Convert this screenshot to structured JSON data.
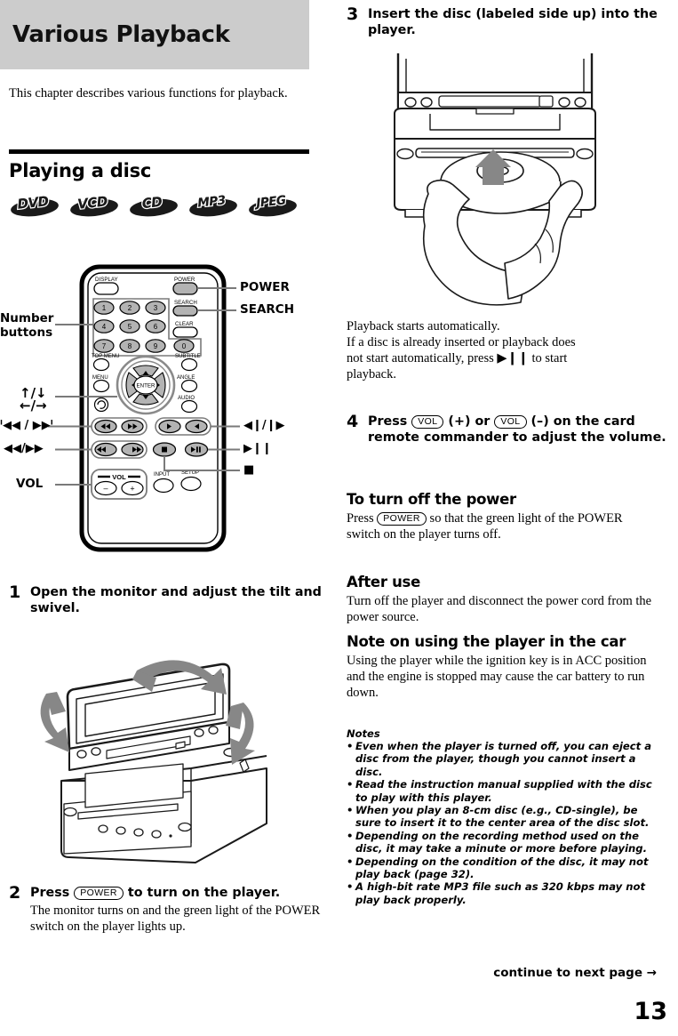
{
  "page": {
    "number": "13",
    "continue_label": "continue to next page",
    "continue_arrow": "→"
  },
  "chapter": {
    "title": "Various Playback",
    "intro": "This chapter describes various functions for playback.",
    "banner_color": "#cccccc"
  },
  "section": {
    "title": "Playing a disc",
    "media_badges": [
      "DVD",
      "VCD",
      "CD",
      "MP3",
      "JPEG"
    ]
  },
  "remote_figure": {
    "callouts_left": [
      {
        "label": "Number\nbuttons",
        "line1": "Number",
        "line2": "buttons"
      },
      {
        "label": "↑/↓",
        "line2": "←/→"
      },
      {
        "label": "ᑊ◀◀ / ▶▶ᑊ"
      },
      {
        "label": "◀◀/▶▶"
      },
      {
        "label": "VOL"
      }
    ],
    "callouts_right": [
      {
        "label": "POWER"
      },
      {
        "label": "SEARCH"
      },
      {
        "label": "◀❙/❙▶"
      },
      {
        "label": "▶❙❙"
      },
      {
        "label": "■"
      }
    ],
    "button_labels": {
      "display": "DISPLAY",
      "power": "POWER",
      "search": "SEARCH",
      "clear": "CLEAR",
      "top_menu": "TOP MENU",
      "subtitle": "SUBTITLE",
      "menu": "MENU",
      "angle": "ANGLE",
      "audio": "AUDIO",
      "enter": "ENTER",
      "input": "INPUT",
      "setup": "SETUP",
      "vol": "VOL",
      "vol_minus": "–",
      "vol_plus": "+"
    },
    "number_keys": [
      "1",
      "2",
      "3",
      "4",
      "5",
      "6",
      "7",
      "8",
      "9",
      "0"
    ]
  },
  "steps": [
    {
      "num": "1",
      "head": "Open the monitor and adjust the tilt and swivel.",
      "body": ""
    },
    {
      "num": "2",
      "head_pre": "Press ",
      "key": "POWER",
      "head_post": " to turn on the player.",
      "body": "The monitor turns on and the green light of the POWER switch on the player lights up."
    },
    {
      "num": "3",
      "head": "Insert the disc  (labeled side up) into the player.",
      "body_lines": [
        "Playback starts automatically.",
        "If a disc is already inserted or playback does",
        "not start automatically, press ▶❙❙ to start",
        "playback."
      ]
    },
    {
      "num": "4",
      "head_pre": "Press ",
      "key": "VOL",
      "head_mid": " (+) or ",
      "key2": "VOL",
      "head_post": " (–) on the card remote commander to adjust the volume."
    }
  ],
  "sections_right": [
    {
      "heading": "To turn off the power",
      "text_pre": "Press ",
      "key": "POWER",
      "text_post": " so that the green light of the POWER switch on the player turns off."
    },
    {
      "heading": "After use",
      "text": "Turn off the player and disconnect the power cord from the power source."
    },
    {
      "heading": "Note on using the player in the car",
      "text": "Using the player while the ignition key is in ACC position and the engine is stopped may cause the car battery to run down."
    }
  ],
  "notes": {
    "title": "Notes",
    "items": [
      "Even when the player is turned off, you can eject a disc from the player, though you cannot insert a disc.",
      "Read the instruction manual supplied with the disc to play with this player.",
      "When you play an 8-cm disc (e.g., CD-single), be sure to insert it to the center area of the disc slot.",
      "Depending on the recording method used on the disc, it may take a minute or more before playing.",
      "Depending on the condition of the disc, it may not play back (page 32).",
      "A high-bit rate MP3 file such as 320 kbps may not play back properly."
    ]
  }
}
